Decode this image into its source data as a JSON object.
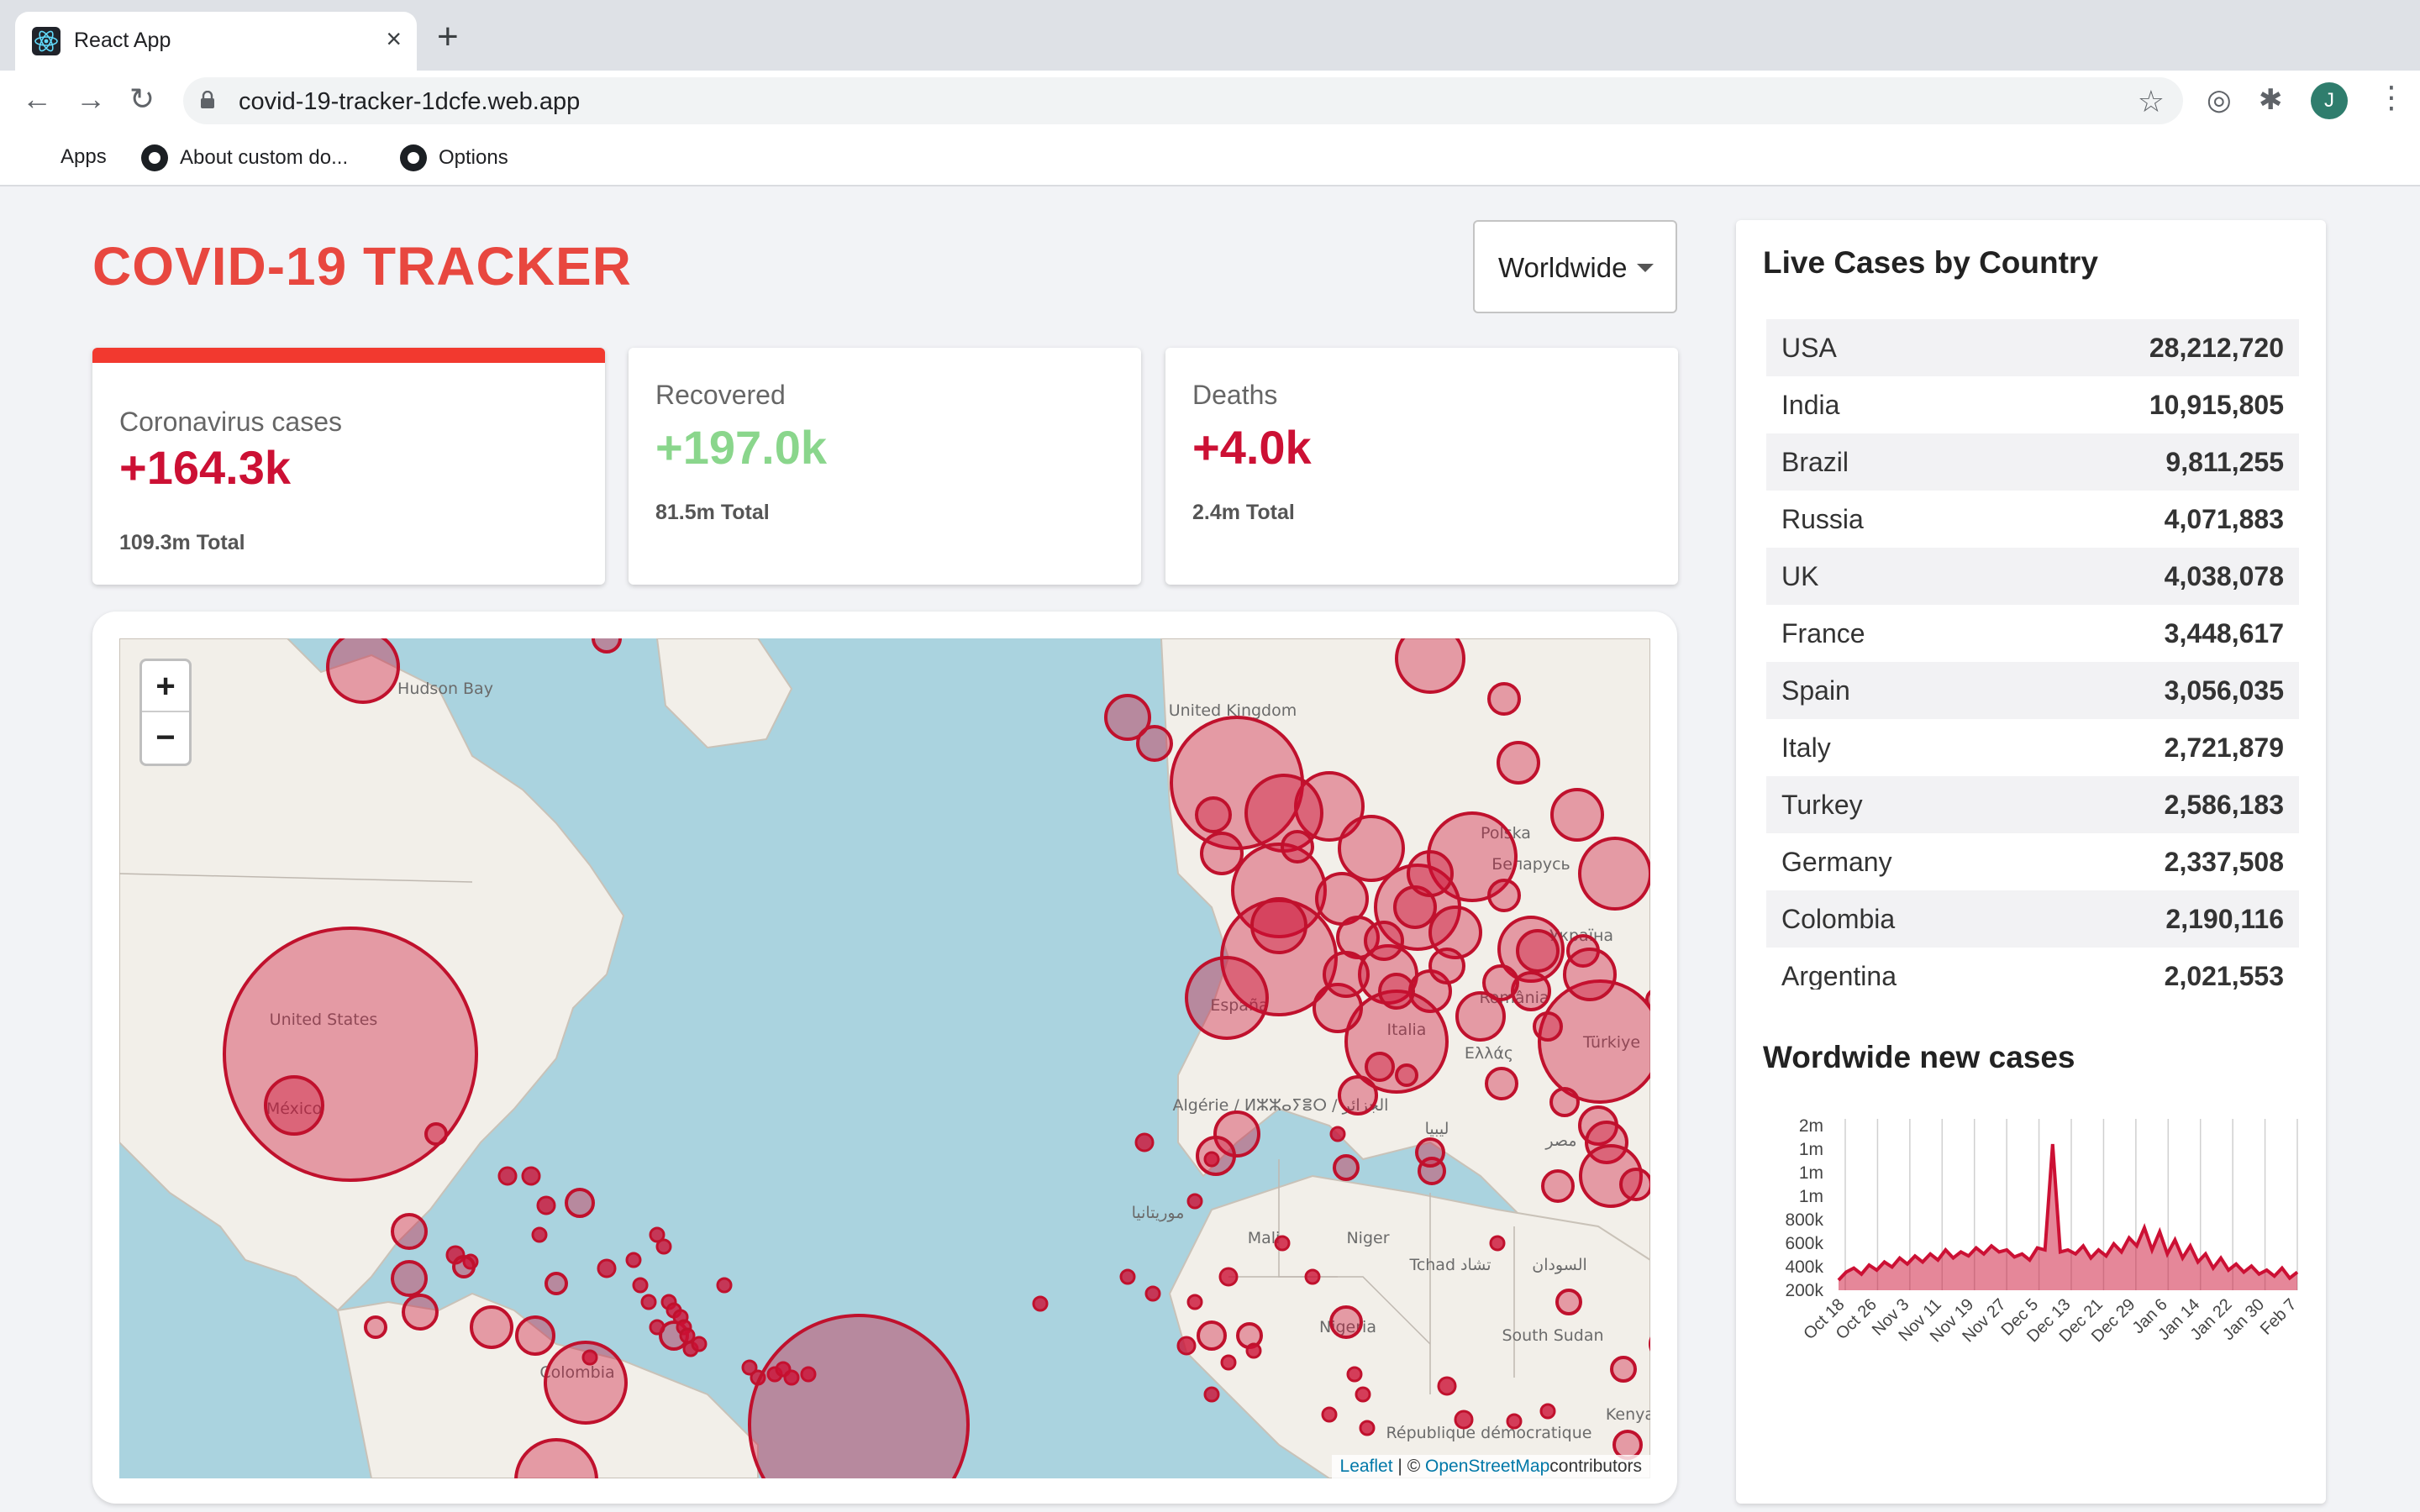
{
  "browser": {
    "tab_title": "React App",
    "tab_close": "×",
    "new_tab": "+",
    "url": "covid-19-tracker-1dcfe.web.app",
    "profile_initial": "J",
    "bookmarks": [
      "Apps",
      "About custom do...",
      "Options"
    ]
  },
  "app": {
    "title": "COVID-19 TRACKER",
    "country_select": "Worldwide"
  },
  "stats": [
    {
      "title": "Coronavirus cases",
      "value": "+164.3k",
      "total": "109.3m Total",
      "color": "#cc1034",
      "selected": true
    },
    {
      "title": "Recovered",
      "value": "+197.0k",
      "total": "81.5m Total",
      "color": "#7dd71d",
      "selected": false
    },
    {
      "title": "Deaths",
      "value": "+4.0k",
      "total": "2.4m Total",
      "color": "#cc1034",
      "selected": false
    }
  ],
  "map": {
    "zoom_in": "+",
    "zoom_out": "−",
    "attribution_leaflet": "Leaflet",
    "attribution_sep": " | © ",
    "attribution_osm": "OpenStreetMap",
    "attribution_rest": "contributors",
    "labels": [
      "Hudson Bay",
      "United States",
      "México",
      "Colombia",
      "United Kingdom",
      "Polska",
      "España",
      "Italia",
      "România",
      "Україна",
      "Беларусь",
      "Türkiye",
      "Ελλάς",
      "Algérie / ⵍⵣⵣⴰⵢⴻⵔ / الجزائر",
      "ليبيا",
      "مصر",
      "موريتانيا",
      "Mali",
      "Niger",
      "Tchad تشاد",
      "السودان",
      "Nigeria",
      "South Sudan",
      "République démocratique",
      "Kenya"
    ]
  },
  "live_cases": {
    "title": "Live Cases by Country",
    "rows": [
      {
        "country": "USA",
        "cases": "28,212,720"
      },
      {
        "country": "India",
        "cases": "10,915,805"
      },
      {
        "country": "Brazil",
        "cases": "9,811,255"
      },
      {
        "country": "Russia",
        "cases": "4,071,883"
      },
      {
        "country": "UK",
        "cases": "4,038,078"
      },
      {
        "country": "France",
        "cases": "3,448,617"
      },
      {
        "country": "Spain",
        "cases": "3,056,035"
      },
      {
        "country": "Italy",
        "cases": "2,721,879"
      },
      {
        "country": "Turkey",
        "cases": "2,586,183"
      },
      {
        "country": "Germany",
        "cases": "2,337,508"
      },
      {
        "country": "Colombia",
        "cases": "2,190,116"
      },
      {
        "country": "Argentina",
        "cases": "2,021,553"
      }
    ]
  },
  "chart_title": "Wordwide new cases",
  "colors": {
    "accent": "#e8473f",
    "circle_fill": "#cc1034",
    "circle_stroke": "#c0112d"
  },
  "chart_data": {
    "type": "area",
    "title": "Wordwide new cases",
    "y_tick_labels": [
      "2m",
      "1m",
      "1m",
      "1m",
      "800k",
      "600k",
      "400k",
      "200k"
    ],
    "x_tick_labels": [
      "Oct 18",
      "Oct 26",
      "Nov 3",
      "Nov 11",
      "Nov 19",
      "Nov 27",
      "Dec 5",
      "Dec 13",
      "Dec 21",
      "Dec 29",
      "Jan 6",
      "Jan 14",
      "Jan 22",
      "Jan 30",
      "Feb 7"
    ],
    "ylim": [
      200000,
      1900000
    ],
    "grid": "vertical",
    "values": [
      300000,
      380000,
      420000,
      360000,
      450000,
      400000,
      480000,
      430000,
      520000,
      460000,
      540000,
      480000,
      560000,
      500000,
      600000,
      520000,
      580000,
      540000,
      620000,
      560000,
      640000,
      580000,
      600000,
      530000,
      560000,
      500000,
      620000,
      600000,
      1650000,
      580000,
      600000,
      560000,
      640000,
      520000,
      600000,
      540000,
      660000,
      580000,
      720000,
      640000,
      820000,
      600000,
      780000,
      560000,
      700000,
      520000,
      640000,
      480000,
      560000,
      420000,
      520000,
      400000,
      460000,
      380000,
      440000,
      360000,
      400000,
      340000,
      420000,
      320000,
      380000
    ]
  }
}
